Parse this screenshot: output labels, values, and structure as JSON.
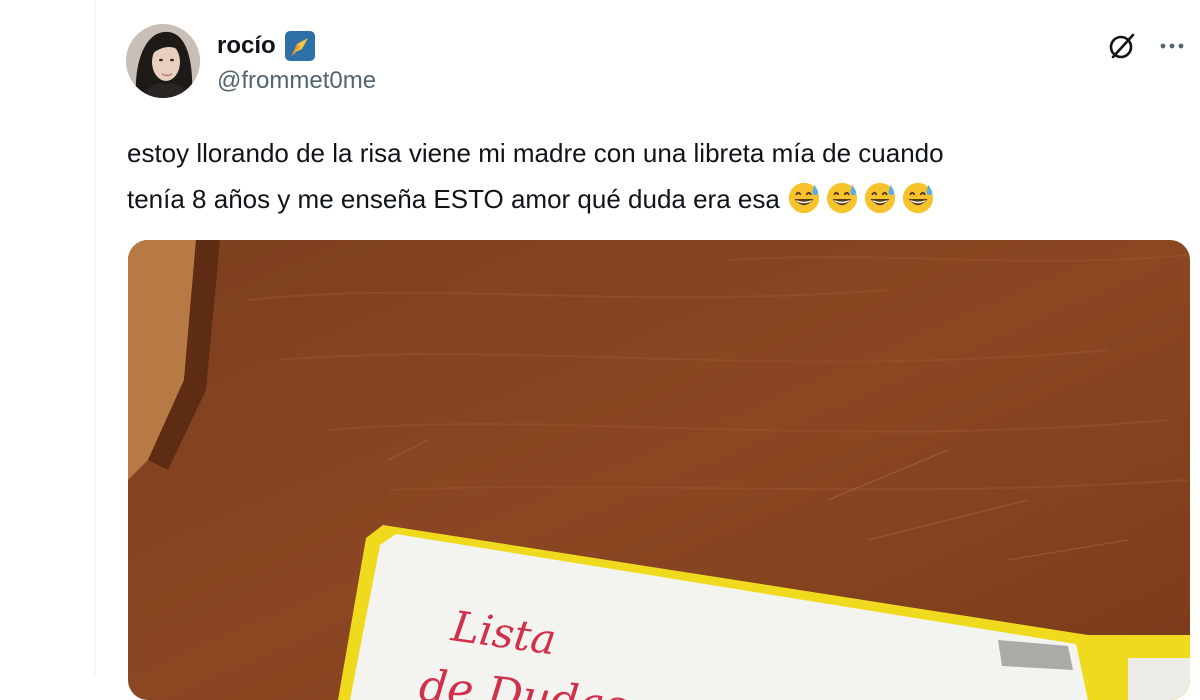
{
  "author": {
    "display_name": "rocío",
    "handle": "@frommet0me",
    "badge_icon": "verified-rocket-badge-icon"
  },
  "header_actions": {
    "grok_icon": "grok-icon",
    "more_icon": "more-options-icon"
  },
  "tweet": {
    "text_line1": "estoy llorando de la risa viene mi madre con una libreta mía de cuando",
    "text_line2": "tenía 8 años y me enseña ESTO amor qué duda era esa",
    "emoji_name": "grinning-face-with-sweat",
    "emoji_count": 4
  },
  "media": {
    "handwriting_line1": "Lista",
    "handwriting_line2": "de Dudas"
  },
  "colors": {
    "text_primary": "#0f1419",
    "text_secondary": "#536471",
    "wood": "#8a4722",
    "notebook_edge": "#f2dc1b",
    "ink": "#d0304a"
  }
}
